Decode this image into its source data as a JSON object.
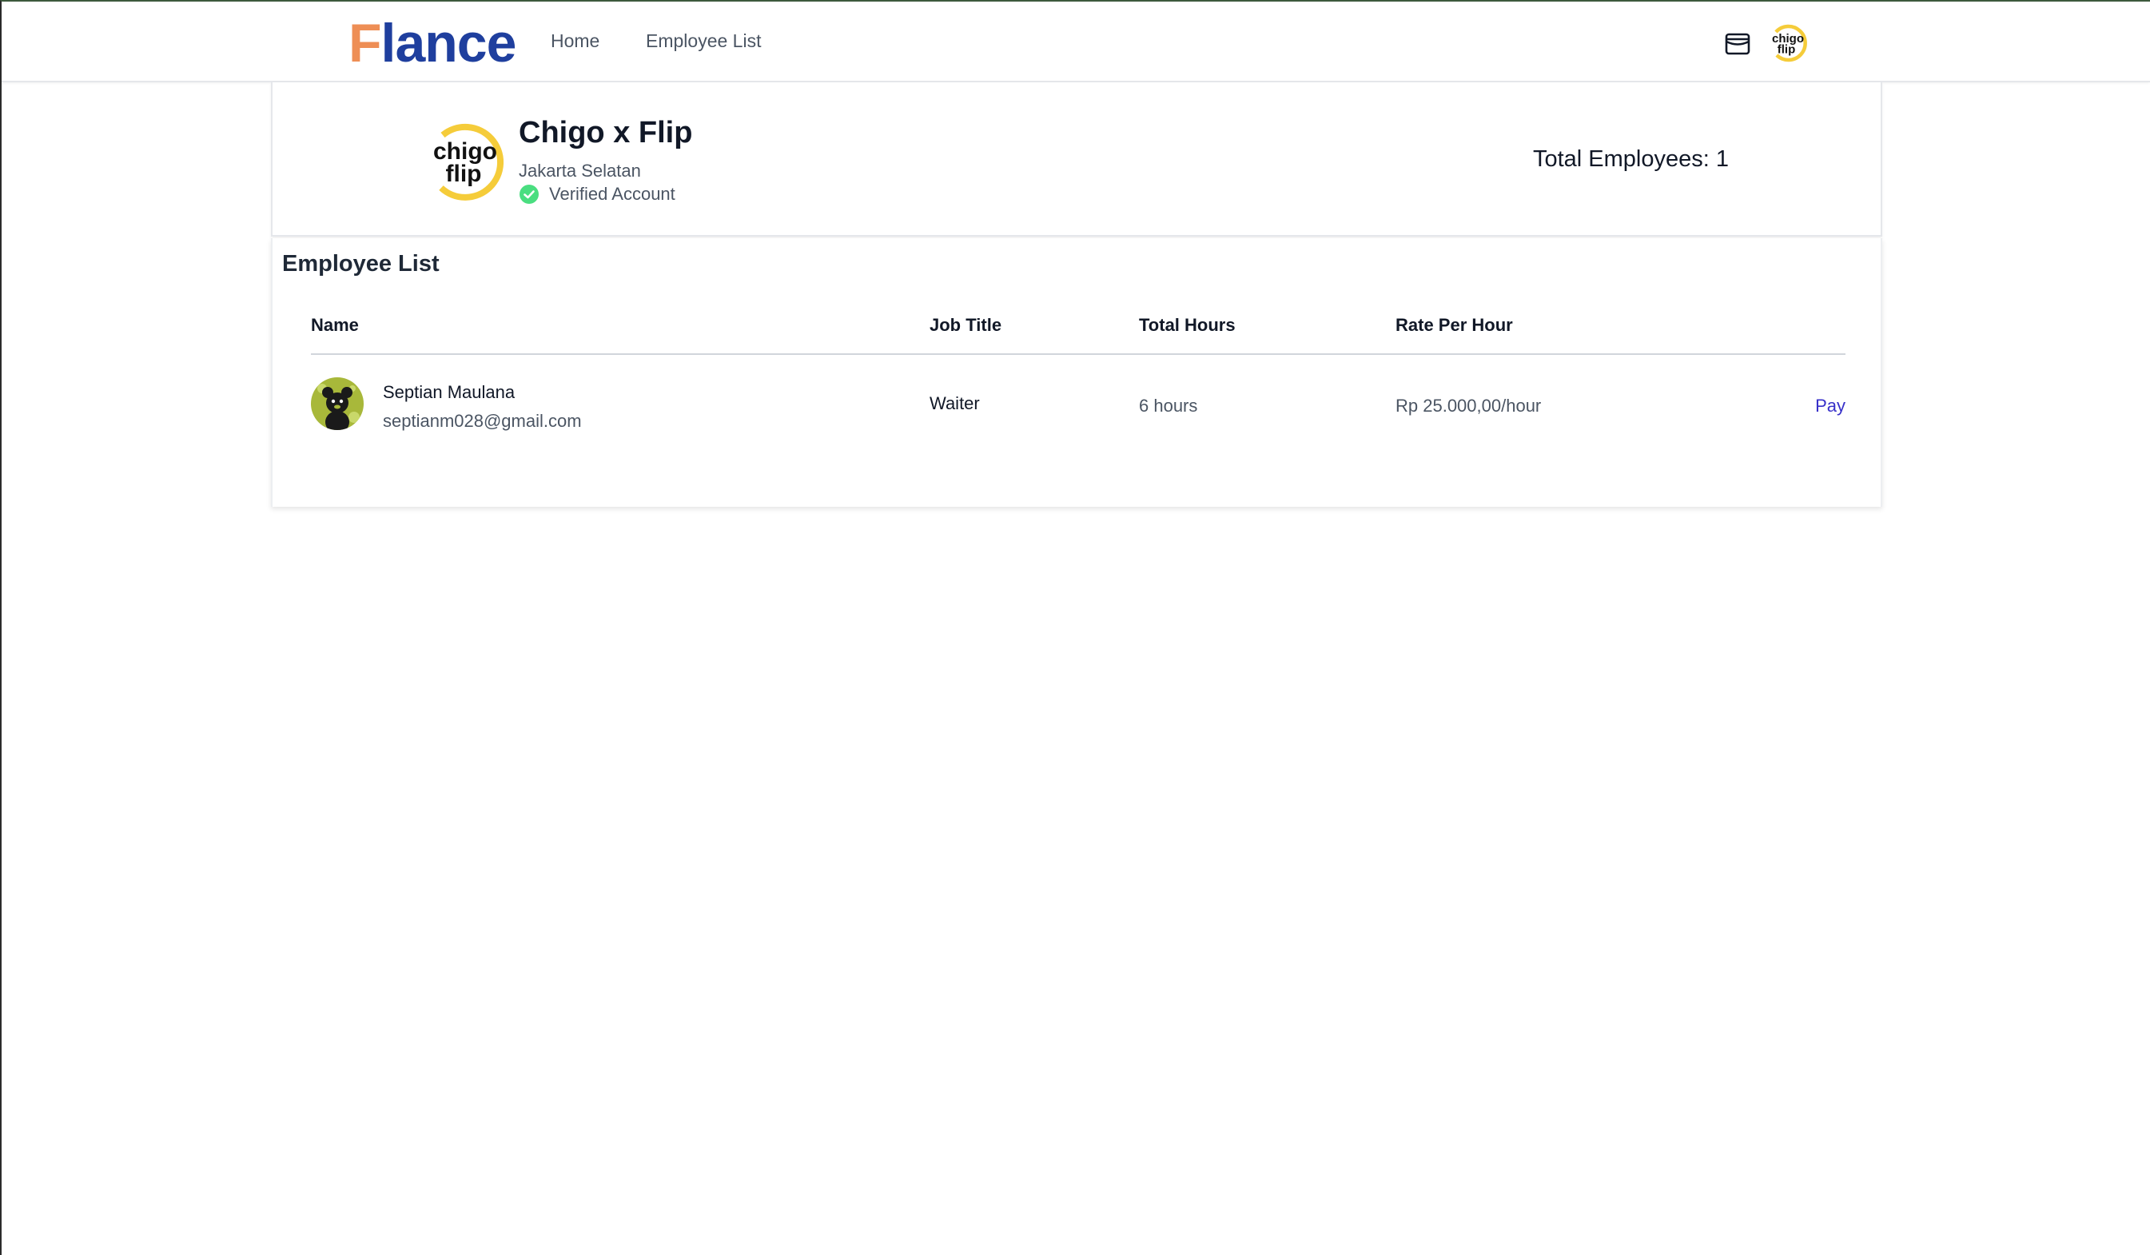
{
  "navbar": {
    "brand_first": "F",
    "brand_rest": "lance",
    "links": [
      {
        "label": "Home"
      },
      {
        "label": "Employee List"
      }
    ],
    "icons": {
      "wallet": "wallet-icon",
      "avatar": "company-logo"
    }
  },
  "company": {
    "name": "Chigo x Flip",
    "city": "Jakarta Selatan",
    "verified_label": "Verified Account",
    "logo_text_top": "chigo",
    "logo_text_bottom": "flip",
    "total_employees": "Total Employees: 1"
  },
  "employee_list": {
    "title": "Employee List",
    "columns": [
      "Name",
      "Job Title",
      "Total Hours",
      "Rate Per Hour"
    ],
    "rows": [
      {
        "name": "Septian Maulana",
        "email": "septianm028@gmail.com",
        "job_title": "Waiter",
        "total_hours": "6 hours",
        "rate": "Rp 25.000,00/hour",
        "action": "Pay"
      }
    ]
  },
  "colors": {
    "brand_orange": "#ee8e55",
    "brand_blue": "#1f3f9e",
    "pay_link": "#3730c9",
    "verified_green": "#4ade80",
    "logo_yellow": "#f5cc3a"
  }
}
